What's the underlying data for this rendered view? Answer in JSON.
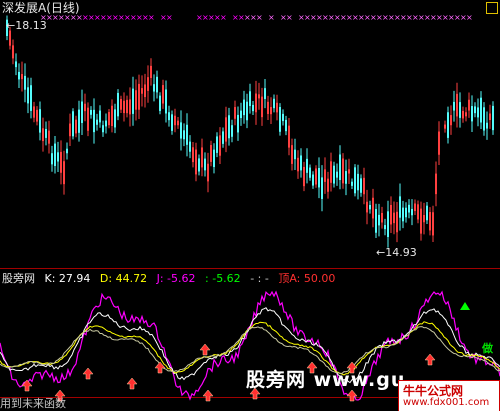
{
  "window": {
    "title": "深发展A(日线)"
  },
  "price": {
    "high_label": "18.13",
    "low_label": "14.93"
  },
  "indicator": {
    "name": "股旁网",
    "k": "K: 27.94",
    "d": "D: 44.72",
    "j": "J: -5.62",
    "extra": ": -5.62",
    "dash": "- : -",
    "top": "顶A: 50.00"
  },
  "footer": {
    "hint": "用到未来函数"
  },
  "watermark": {
    "main": "股旁网 www.gu",
    "site_title": "牛牛公式网",
    "site_url": "www.fdx001.com"
  },
  "signal_label": "做",
  "colors": {
    "bg": "#000000",
    "up": "#ff4040",
    "down": "#54fcfc",
    "magenta": "#ff00ff",
    "white": "#ffffff",
    "yellow": "#ffff00",
    "green": "#00ff00"
  }
}
